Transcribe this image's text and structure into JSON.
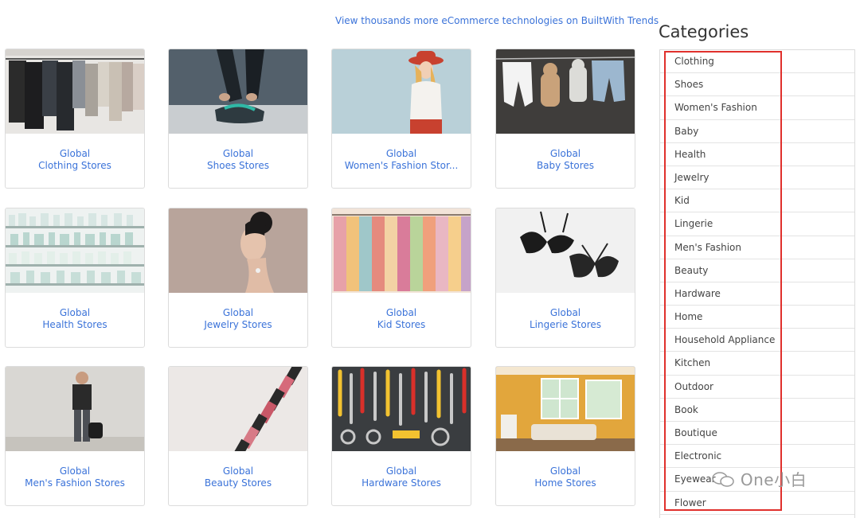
{
  "header": {
    "trends_link": "View thousands more eCommerce technologies on BuiltWith Trends"
  },
  "cards": [
    {
      "line1": "Global",
      "line2": "Clothing Stores"
    },
    {
      "line1": "Global",
      "line2": "Shoes Stores"
    },
    {
      "line1": "Global",
      "line2": "Women's Fashion Stor..."
    },
    {
      "line1": "Global",
      "line2": "Baby Stores"
    },
    {
      "line1": "Global",
      "line2": "Health Stores"
    },
    {
      "line1": "Global",
      "line2": "Jewelry Stores"
    },
    {
      "line1": "Global",
      "line2": "Kid Stores"
    },
    {
      "line1": "Global",
      "line2": "Lingerie Stores"
    },
    {
      "line1": "Global",
      "line2": "Men's Fashion Stores"
    },
    {
      "line1": "Global",
      "line2": "Beauty Stores"
    },
    {
      "line1": "Global",
      "line2": "Hardware Stores"
    },
    {
      "line1": "Global",
      "line2": "Home Stores"
    }
  ],
  "sidebar": {
    "title": "Categories",
    "items": [
      "Clothing",
      "Shoes",
      "Women's Fashion",
      "Baby",
      "Health",
      "Jewelry",
      "Kid",
      "Lingerie",
      "Men's Fashion",
      "Beauty",
      "Hardware",
      "Home",
      "Household Appliance",
      "Kitchen",
      "Outdoor",
      "Book",
      "Boutique",
      "Electronic",
      "Eyewear",
      "Flower"
    ]
  },
  "watermark": {
    "text": "One小白"
  },
  "colors": {
    "link": "#3b73d9",
    "highlight_box": "#e0302c"
  }
}
